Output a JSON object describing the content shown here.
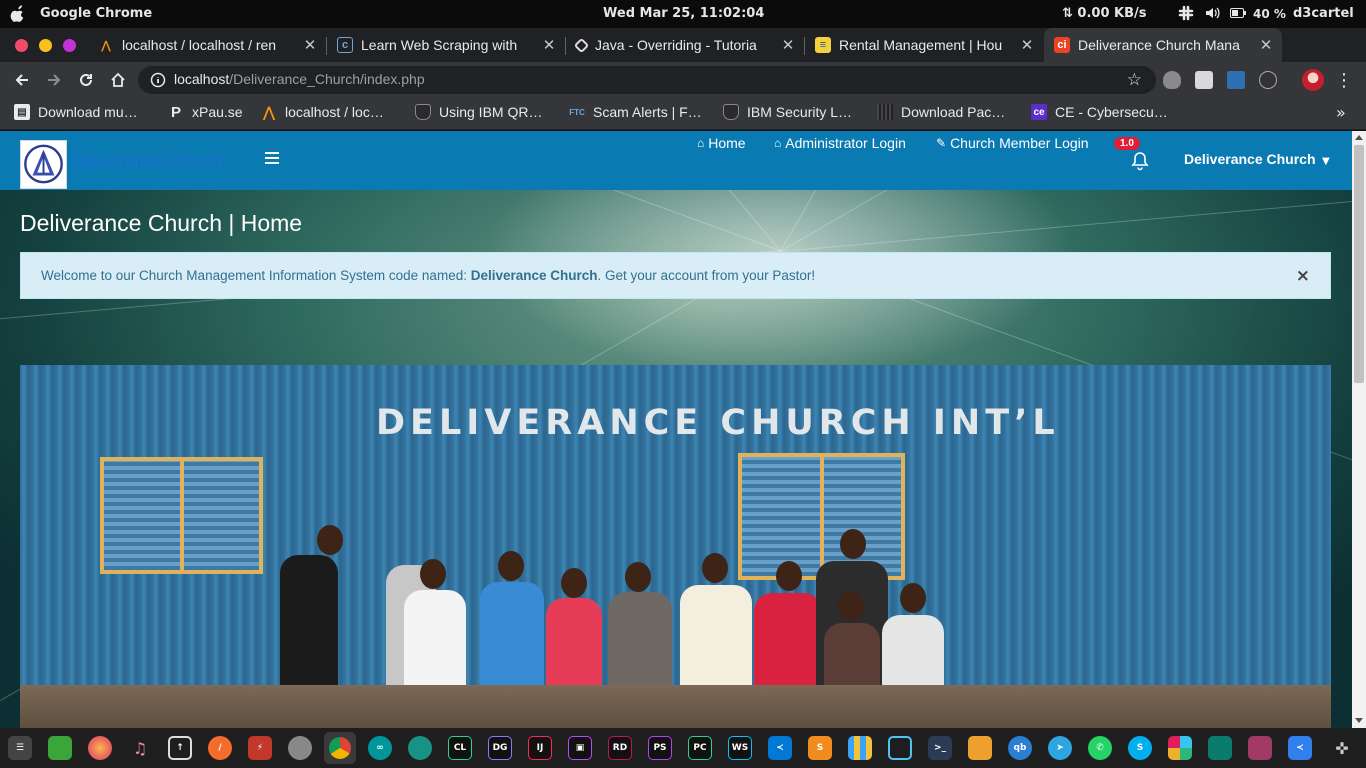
{
  "os_bar": {
    "app_name": "Google Chrome",
    "clock": "Wed Mar 25, 11:02:04",
    "net_speed": "⇅ 0.00 KB/s",
    "battery": "40 %",
    "user": "d3cartel"
  },
  "tabs": [
    {
      "title": "localhost / localhost / ren",
      "icon": "phpmyadmin-icon",
      "active": false
    },
    {
      "title": "Learn Web Scraping with",
      "icon": "code-doc-icon",
      "active": false
    },
    {
      "title": "Java - Overriding - Tutoria",
      "icon": "tutorialspoint-icon",
      "active": false
    },
    {
      "title": "Rental Management | Hou",
      "icon": "notepad-icon",
      "active": false
    },
    {
      "title": "Deliverance Church Mana",
      "icon": "codeigniter-icon",
      "active": true
    }
  ],
  "toolbar": {
    "url_host": "localhost",
    "url_path": "/Deliverance_Church/index.php"
  },
  "bookmarks": [
    {
      "label": "Download mu…",
      "icon": "file-icon"
    },
    {
      "label": "xPau.se",
      "icon": "p-icon"
    },
    {
      "label": "localhost / loc…",
      "icon": "phpmyadmin-icon"
    },
    {
      "label": "Using IBM QR…",
      "icon": "shield-icon"
    },
    {
      "label": "Scam Alerts | F…",
      "icon": "ftc-icon"
    },
    {
      "label": "IBM Security L…",
      "icon": "shield-icon"
    },
    {
      "label": "Download Pac…",
      "icon": "grid-icon"
    },
    {
      "label": "CE - Cybersecu…",
      "icon": "ce-icon"
    }
  ],
  "navbar": {
    "brand": "Deliverance Church",
    "links": [
      "Home",
      "Administrator Login",
      "Church Member Login"
    ],
    "notification_count": "1.0",
    "user_menu": "Deliverance Church"
  },
  "page": {
    "title": "Deliverance Church | Home",
    "alert_prefix": "Welcome to our Church Management Information System code named: ",
    "alert_bold": "Deliverance Church",
    "alert_suffix": ". Get your account from your Pastor!",
    "alert_close": "×",
    "hero_sign": "DELIVERANCE CHURCH INT’L"
  },
  "dock": [
    "terminal",
    "files",
    "firefox-dev",
    "music",
    "software",
    "sublime",
    "transmission",
    "database",
    "chrome",
    "arduino",
    "gitkraken",
    "clion",
    "datagrip",
    "intellij",
    "phpstorm-alt",
    "rider",
    "phpstorm",
    "pycharm",
    "webstorm",
    "vscode",
    "sublime-text",
    "apps",
    "cube",
    "terminal-alt",
    "folder",
    "qbittorrent",
    "telegram",
    "whatsapp",
    "skype",
    "slack",
    "gitbook",
    "screen-recorder",
    "vscodium",
    "games"
  ]
}
